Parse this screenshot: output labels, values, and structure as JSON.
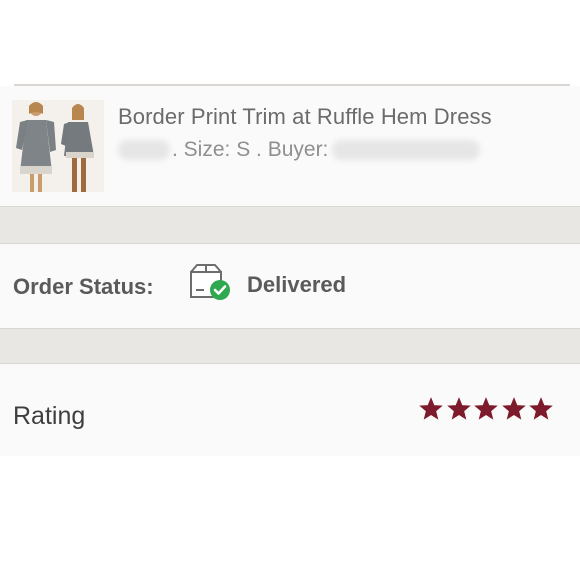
{
  "item": {
    "title": "Border Print Trim at Ruffle Hem Dress",
    "size_text": ". Size: S . Buyer:",
    "thumbnail_icon": "dress-photo-icon"
  },
  "order": {
    "status_label": "Order Status:",
    "status_value": "Delivered",
    "status_icon": "package-delivered-icon",
    "check_color": "#2fa84f"
  },
  "rating": {
    "label": "Rating",
    "stars_filled": 5,
    "stars_total": 5,
    "star_color": "#7d1a2b"
  }
}
